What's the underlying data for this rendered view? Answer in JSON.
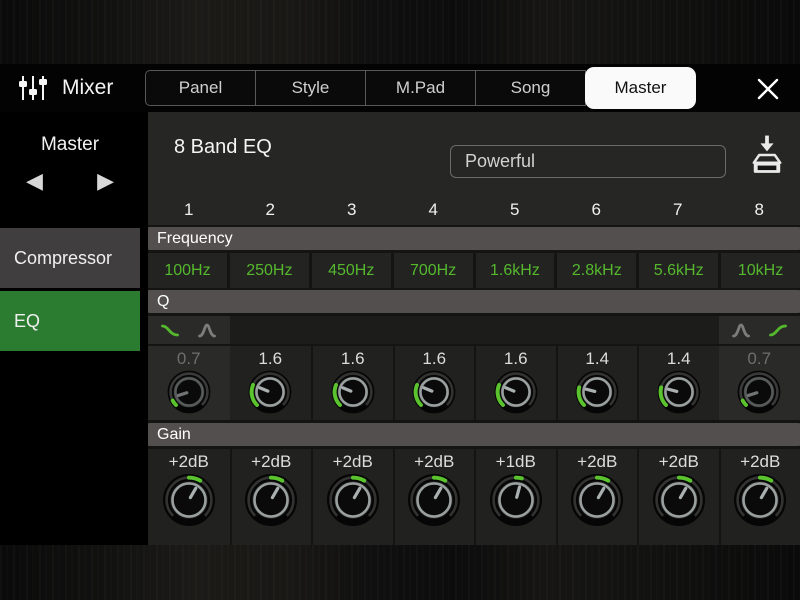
{
  "header": {
    "title": "Mixer",
    "tabs": [
      {
        "label": "Panel",
        "selected": false
      },
      {
        "label": "Style",
        "selected": false
      },
      {
        "label": "M.Pad",
        "selected": false
      },
      {
        "label": "Song",
        "selected": false
      },
      {
        "label": "Master",
        "selected": true
      }
    ],
    "icons": {
      "app": "mixer-sliders-icon",
      "close": "close-x-icon"
    }
  },
  "sidebar": {
    "group_label": "Master",
    "nav_icons": {
      "prev": "◀",
      "next": "▶"
    },
    "items": [
      {
        "label": "Compressor",
        "selected": false
      },
      {
        "label": "EQ",
        "selected": true
      }
    ]
  },
  "main": {
    "title": "8 Band EQ",
    "preset": "Powerful",
    "save_icon": "save-to-disk-icon",
    "bands": [
      "1",
      "2",
      "3",
      "4",
      "5",
      "6",
      "7",
      "8"
    ],
    "sections": {
      "frequency": {
        "label": "Frequency",
        "values": [
          "100Hz",
          "250Hz",
          "450Hz",
          "700Hz",
          "1.6kHz",
          "2.8kHz",
          "5.6kHz",
          "10kHz"
        ]
      },
      "q": {
        "label": "Q",
        "bands": [
          {
            "value": "0.7",
            "dimmed": true
          },
          {
            "value": "1.6",
            "dimmed": false
          },
          {
            "value": "1.6",
            "dimmed": false
          },
          {
            "value": "1.6",
            "dimmed": false
          },
          {
            "value": "1.6",
            "dimmed": false
          },
          {
            "value": "1.4",
            "dimmed": false
          },
          {
            "value": "1.4",
            "dimmed": false
          },
          {
            "value": "0.7",
            "dimmed": true
          }
        ],
        "filter_type_buttons": {
          "band1": {
            "options": [
              "low-shelf",
              "peak"
            ],
            "selected": "low-shelf"
          },
          "band8": {
            "options": [
              "peak",
              "high-shelf"
            ],
            "selected": "high-shelf"
          }
        }
      },
      "gain": {
        "label": "Gain",
        "values": [
          "+2dB",
          "+2dB",
          "+2dB",
          "+2dB",
          "+1dB",
          "+2dB",
          "+2dB",
          "+2dB"
        ]
      }
    }
  },
  "colors": {
    "accent_green": "#55b82d",
    "knob_green": "#5ac32e",
    "eq_item_green": "#2b7c31",
    "selected_tab_bg": "#fafafa",
    "section_header_bg": "#544f4f"
  }
}
